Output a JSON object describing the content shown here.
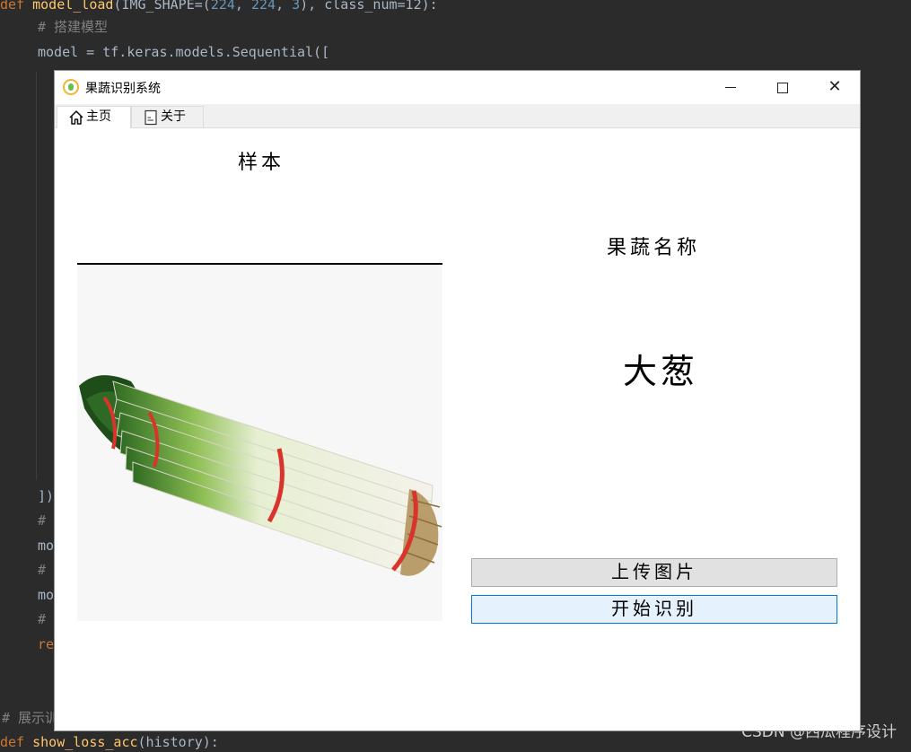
{
  "editor": {
    "line1": {
      "kw": "def",
      "fn": "model_load",
      "rest_a": "(IMG_SHAPE=(",
      "n1": "224",
      "s1": ", ",
      "n2": "224",
      "s2": ", ",
      "n3": "3",
      "rest_b": "), class_num=12):"
    },
    "line2": "# 搭建模型",
    "line3": "model = tf.keras.models.Sequential([",
    "line_close": "])",
    "line_hash1": "#",
    "line_mo1": "mo",
    "line_hash2": "#",
    "line_mo2": "mo",
    "line_hash3": "#",
    "line_re": "re",
    "line_show": "# 展示训",
    "line_last": {
      "kw": "def",
      "fn": "show_loss_acc",
      "rest": "(history):"
    }
  },
  "watermark": "CSDN @西瓜程序设计",
  "window": {
    "title": "果蔬识别系统",
    "controls": {
      "minimize": "minimize",
      "maximize": "maximize",
      "close": "✕"
    }
  },
  "tabs": [
    {
      "label": "主页",
      "icon": "home-icon",
      "active": true
    },
    {
      "label": "关于",
      "icon": "document-icon",
      "active": false
    }
  ],
  "main": {
    "sample_label": "样本",
    "name_label": "果蔬名称",
    "result": "大葱",
    "upload_button": "上传图片",
    "start_button": "开始识别"
  },
  "colors": {
    "editor_bg": "#2b2b2b",
    "keyword": "#cc7832",
    "function": "#ffc66d",
    "comment": "#808080",
    "number": "#6897bb",
    "start_button_bg": "#e5f1fb",
    "start_button_border": "#0078d7",
    "upload_button_bg": "#e1e1e1"
  }
}
